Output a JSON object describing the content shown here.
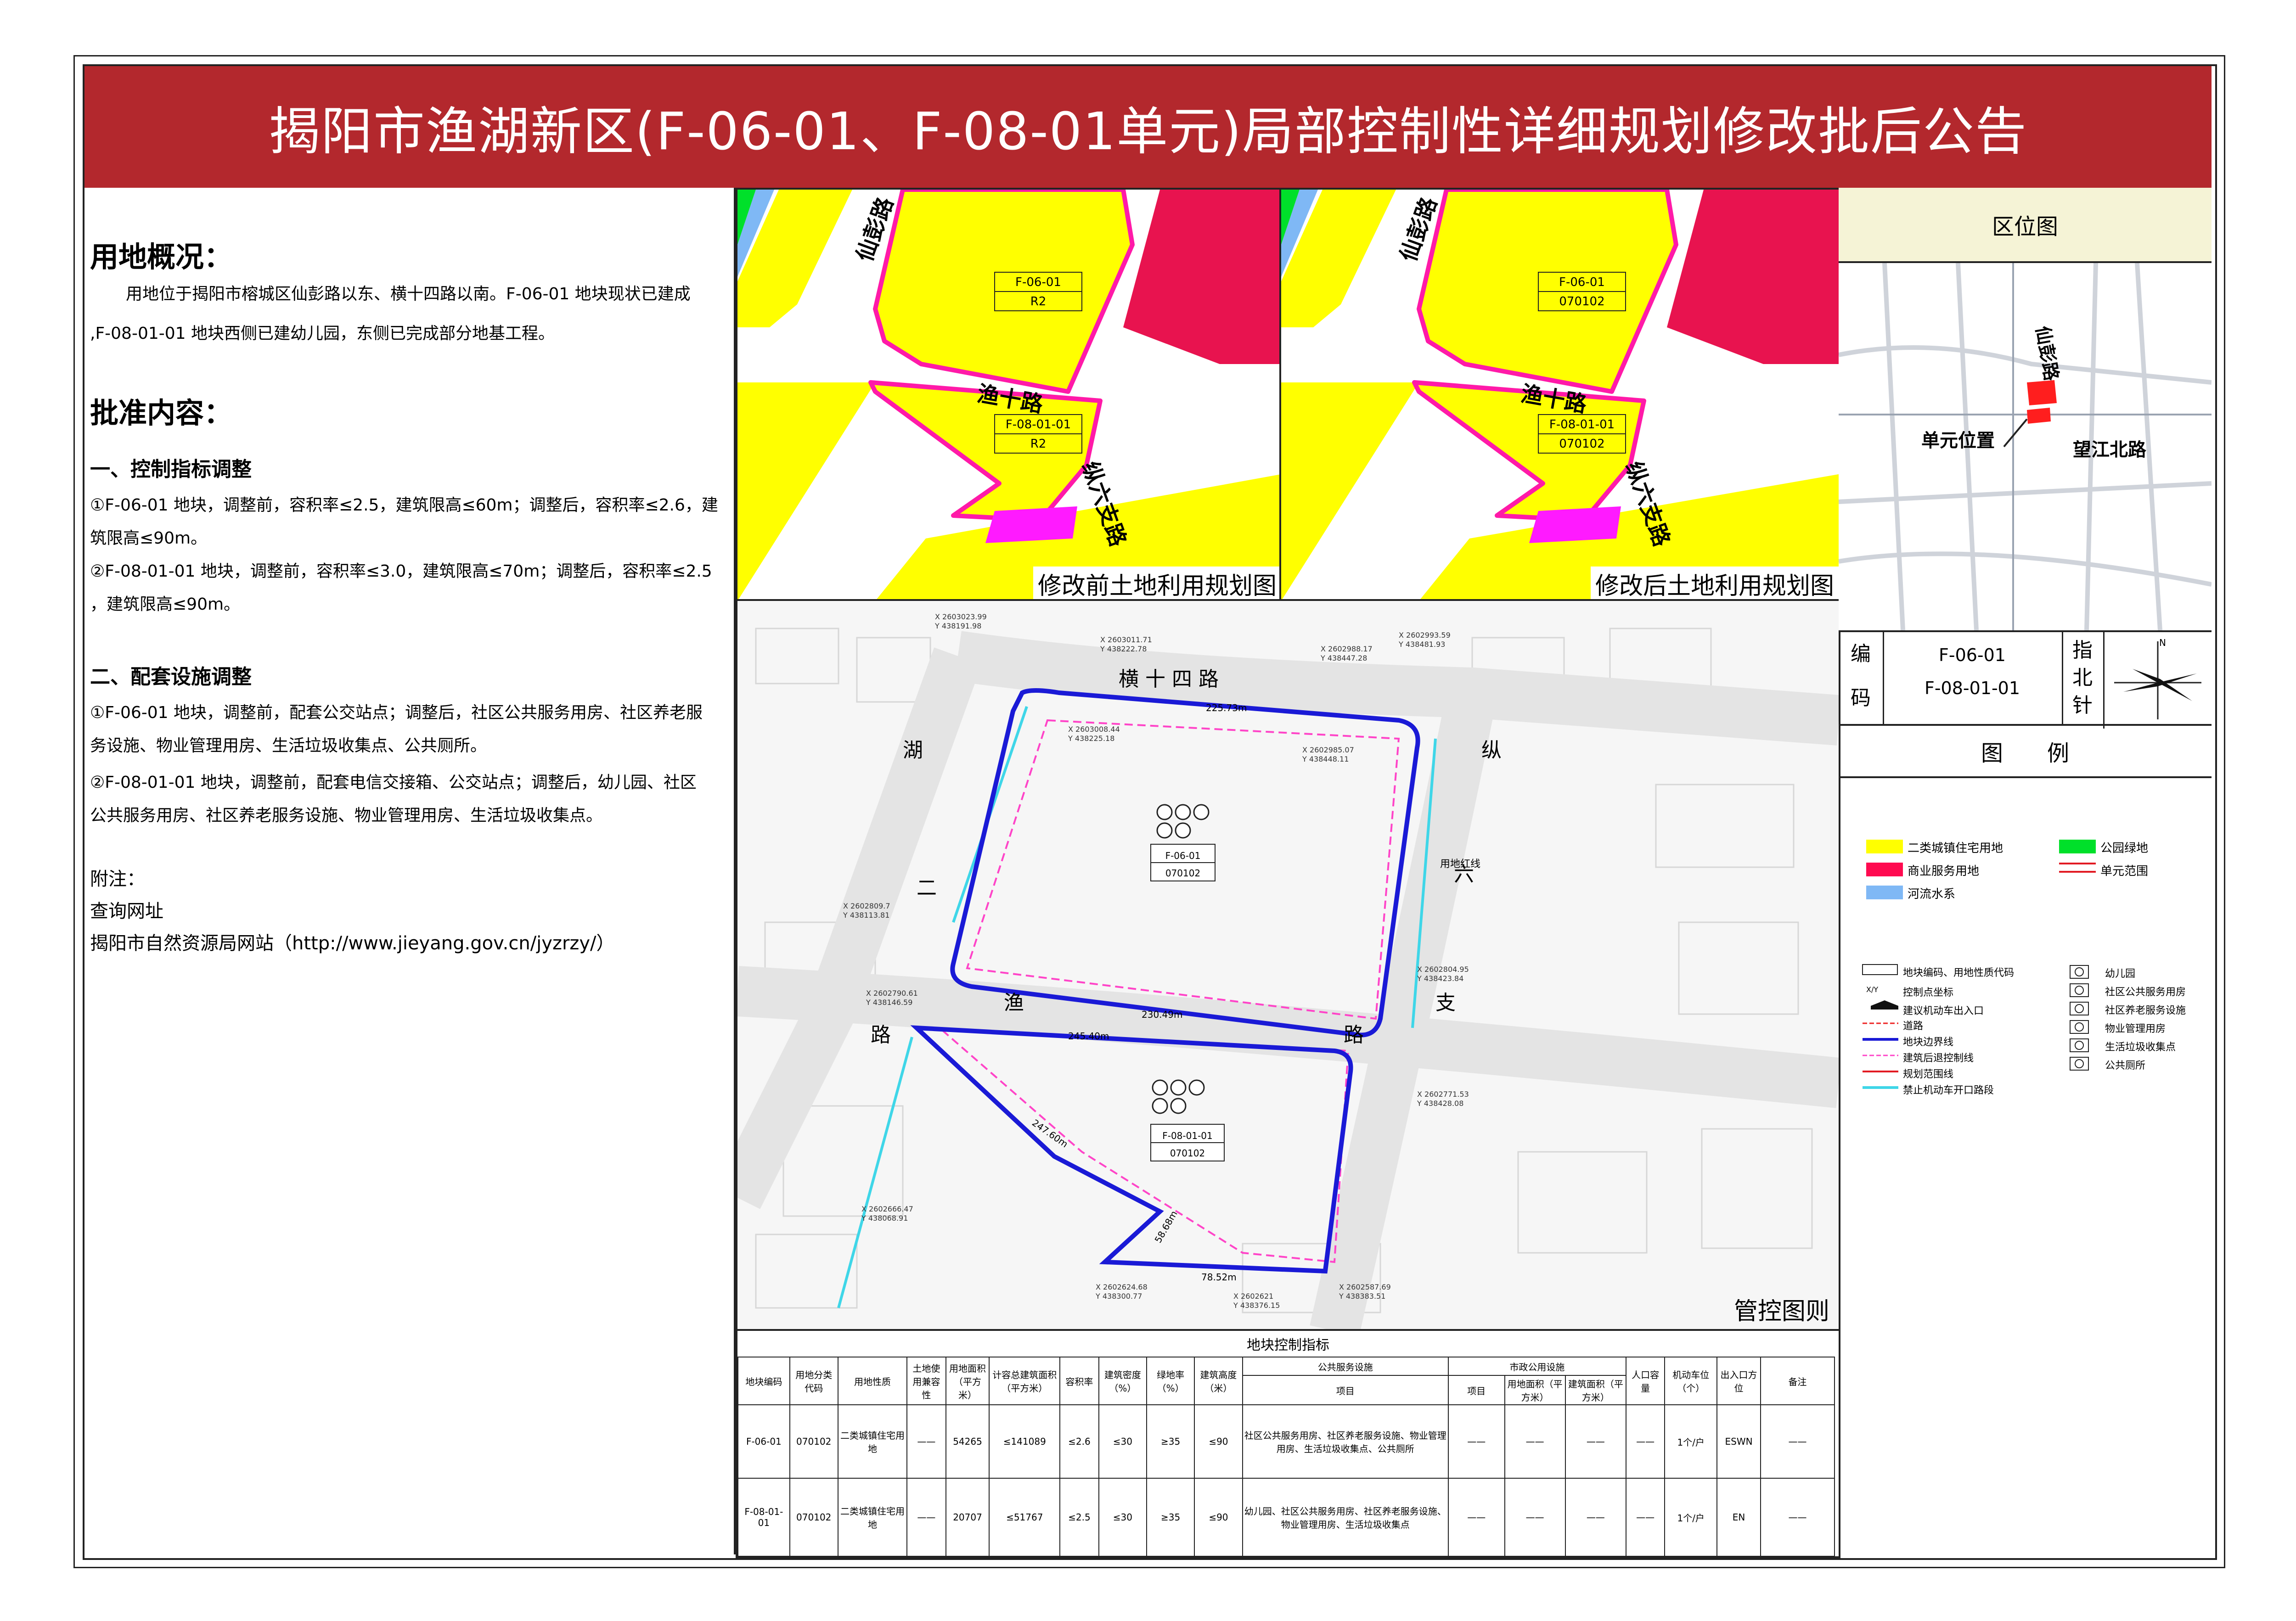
{
  "title": "揭阳市渔湖新区(F-06-01、F-08-01单元)局部控制性详细规划修改批后公告",
  "left": {
    "overview_heading": "用地概况：",
    "overview_text_1": "用地位于揭阳市榕城区仙彭路以东、横十四路以南。F-06-01 地块现状已建成",
    "overview_text_2": ",F-08-01-01 地块西侧已建幼儿园，东侧已完成部分地基工程。",
    "approval_heading": "批准内容：",
    "sec1_heading": "一、控制指标调整",
    "sec1_line1": "①F-06-01 地块，调整前，容积率≤2.5，建筑限高≤60m；调整后，容积率≤2.6，建",
    "sec1_line2": "筑限高≤90m。",
    "sec1_line3": "②F-08-01-01 地块，调整前，容积率≤3.0，建筑限高≤70m；调整后，容积率≤2.5",
    "sec1_line4": "，建筑限高≤90m。",
    "sec2_heading": "二、配套设施调整",
    "sec2_line1": "①F-06-01 地块，调整前，配套公交站点；调整后，社区公共服务用房、社区养老服",
    "sec2_line2": "务设施、物业管理用房、生活垃圾收集点、公共厕所。",
    "sec2_line3": "②F-08-01-01 地块，调整前，配套电信交接箱、公交站点；调整后，幼儿园、社区",
    "sec2_line4": "公共服务用房、社区养老服务设施、物业管理用房、生活垃圾收集点。",
    "note_heading": "附注：",
    "note_line1": "查询网址",
    "note_line2": "揭阳市自然资源局网站（http://www.jieyang.gov.cn/jyzrzy/）"
  },
  "maps": {
    "before_caption": "修改前土地利用规划图",
    "after_caption": "修改后土地利用规划图",
    "control_caption": "管控图则",
    "road_xianpeng": "仙彭路",
    "road_yushi": "渔十路",
    "road_zongliu": "纵六支路",
    "before_a_code": "F-06-01",
    "before_a_use": "R2",
    "before_b_code": "F-08-01-01",
    "before_b_use": "R2",
    "after_a_code": "F-06-01",
    "after_a_use": "070102",
    "after_b_code": "F-08-01-01",
    "after_b_use": "070102",
    "ctrl_road_heng": "横 十 四 路",
    "ctrl_road_hu": "湖",
    "ctrl_road_er": "二",
    "ctrl_road_yu": "渔",
    "ctrl_road_lu1": "路",
    "ctrl_road_zong": "纵",
    "ctrl_road_liu": "六",
    "ctrl_road_zhi": "支",
    "ctrl_road_lu2": "路",
    "ctrl_redline": "用地红线",
    "ctrl_block1": "F-06-01",
    "ctrl_block1_use": "070102",
    "ctrl_block2": "F-08-01-01",
    "ctrl_block2_use": "070102",
    "dim1": "225.73m",
    "dim2": "230.49m",
    "dim3": "245.40m",
    "dim4": "247.60m",
    "dim5": "78.52m",
    "dim6": "58.68m"
  },
  "location": {
    "heading": "区位图",
    "road1": "仙彭路",
    "road2": "望江北路",
    "unit_label": "单元位置"
  },
  "code_box": {
    "label1": "编",
    "label2": "码",
    "code1": "F-06-01",
    "code2": "F-08-01-01",
    "north1": "指",
    "north2": "北",
    "north3": "针",
    "north_n": "N"
  },
  "legend": {
    "heading": "图　　例",
    "items": [
      {
        "label": "二类城镇住宅用地",
        "color": "#ffff00"
      },
      {
        "label": "公园绿地",
        "color": "#00e02a"
      },
      {
        "label": "商业服务用地",
        "color": "#ff0a50"
      },
      {
        "label": "单元范围",
        "color": "#e21b23"
      },
      {
        "label": "河流水系",
        "color": "#7fb8f5"
      }
    ],
    "items2": [
      "地块编码、用地性质代码",
      "控制点坐标",
      "建议机动车出入口",
      "道路",
      "地块边界线",
      "建筑后退控制线",
      "规划范围线",
      "禁止机动车开口路段"
    ],
    "items3": [
      "幼儿园",
      "社区公共服务用房",
      "社区养老服务设施",
      "物业管理用房",
      "生活垃圾收集点",
      "公共厕所"
    ]
  },
  "table": {
    "caption": "地块控制指标",
    "headers": [
      "地块编码",
      "用地分类代码",
      "用地性质",
      "土地使用兼容性",
      "用地面积（平方米）",
      "计容总建筑面积（平方米）",
      "容积率",
      "建筑密度（%）",
      "绿地率（%）",
      "建筑高度（米）"
    ],
    "group_public": "公共服务设施",
    "group_public_item": "项目",
    "group_muni": "市政公用设施",
    "muni_cols": [
      "项目",
      "用地面积（平方米）",
      "建筑面积（平方米）"
    ],
    "tail_cols": [
      "人口容量",
      "机动车位（个）",
      "出入口方位",
      "备注"
    ],
    "rows": [
      {
        "code": "F-06-01",
        "cls": "070102",
        "nature": "二类城镇住宅用地",
        "compat": "——",
        "area": "54265",
        "gfa": "≤141089",
        "far": "≤2.6",
        "density": "≤30",
        "green": "≥35",
        "height": "≤90",
        "public": "社区公共服务用房、社区养老服务设施、物业管理用房、生活垃圾收集点、公共厕所",
        "m1": "——",
        "m2": "——",
        "m3": "——",
        "pop": "——",
        "park": "1个/户",
        "access": "ESWN",
        "note": "——"
      },
      {
        "code": "F-08-01-01",
        "cls": "070102",
        "nature": "二类城镇住宅用地",
        "compat": "——",
        "area": "20707",
        "gfa": "≤51767",
        "far": "≤2.5",
        "density": "≤30",
        "green": "≥35",
        "height": "≤90",
        "public": "幼儿园、社区公共服务用房、社区养老服务设施、物业管理用房、生活垃圾收集点",
        "m1": "——",
        "m2": "——",
        "m3": "——",
        "pop": "——",
        "park": "1个/户",
        "access": "EN",
        "note": "——"
      }
    ]
  },
  "coords": [
    "X 2603023.99",
    "Y 438191.98",
    "X 2603011.71",
    "Y 438222.78",
    "X 2602993.59",
    "Y 438481.93",
    "X 2602988.17",
    "Y 438447.28",
    "X 2603008.44",
    "Y 438225.18",
    "X 2602985.07",
    "Y 438448.11",
    "X 2602809.7",
    "Y 438113.81",
    "X 2602790.61",
    "Y 438146.59",
    "X 2602804.95",
    "Y 438423.84",
    "X 2602771.53",
    "Y 438428.08",
    "X 2602666.47",
    "Y 438068.91",
    "X 2602624.68",
    "Y 438300.77",
    "X 2602621",
    "Y 438376.15",
    "X 2602587.69",
    "Y 438383.51"
  ]
}
